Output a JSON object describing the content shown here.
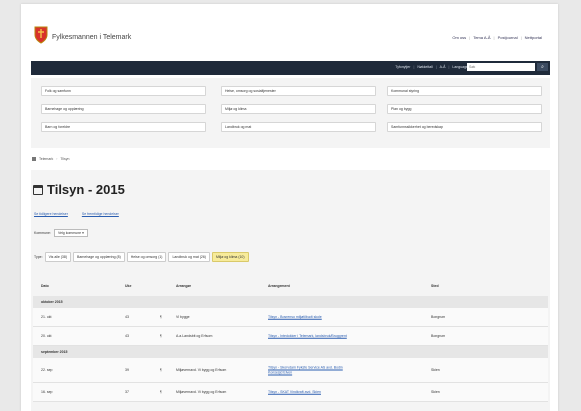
{
  "header": {
    "site_title": "Fylkesmannen i Telemark",
    "top_links": [
      "Om oss",
      "Tema A-Å",
      "Postjournal",
      "Nettportal"
    ]
  },
  "navbar": {
    "links": [
      "Tyfonytjer",
      "Nøkkeltall",
      "A-Å",
      "Language"
    ],
    "search_placeholder": "Søk",
    "search_icon_glyph": "⌕"
  },
  "menu": {
    "col1": [
      "Folk og samfunn",
      "Barnehage og opplæring",
      "Barn og foreldre"
    ],
    "col2": [
      "Helse, omsorg og sosialtjenester",
      "Miljø og klima",
      "Landbruk og mat"
    ],
    "col3": [
      "Kommunal styring",
      "Plan og bygg",
      "Samfunnssikkerhet og beredskap"
    ]
  },
  "breadcrumb": [
    "Telemark",
    "Tilsyn"
  ],
  "page": {
    "title": "Tilsyn - 2015",
    "sub_links": [
      "Se tidligere hendelser",
      "Se fremtidige hendelser"
    ],
    "kommune_label": "Kommune:",
    "kommune_value": "Velg kommune",
    "type_label": "Type:",
    "type_filters": [
      {
        "label": "Vis alle (38)",
        "active": false
      },
      {
        "label": "Barnehage og opplæring (8)",
        "active": false
      },
      {
        "label": "Helse og omsorg (1)",
        "active": false
      },
      {
        "label": "Landbruk og mat (26)",
        "active": false
      },
      {
        "label": "Miljø og klima (10)",
        "active": true
      }
    ]
  },
  "table": {
    "headers": [
      "Dato",
      "Uke",
      "Arrangør",
      "Arrangement",
      "Sted"
    ],
    "groups": [
      {
        "label": "oktober 2015",
        "rows": [
          {
            "dato": "21. okt",
            "uke": "43",
            "icon": "¶",
            "arr": "Vi bygge",
            "event": "Tilsyn - Bosrenso miljøtilbudt skole",
            "sted": "Bongrum"
          },
          {
            "dato": "20. okt",
            "uke": "43",
            "icon": "¶",
            "arr": "A.a.Landsbit og Erfsom",
            "event": "Tilsyn - Intedokker i Telemark, landsbruk/Bruggrent",
            "sted": "Bongrum"
          }
        ]
      },
      {
        "label": "september 2015",
        "rows": [
          {
            "dato": "22. sep",
            "uke": "39",
            "icon": "¶",
            "arr": "Miljøvernavd. Vi bygg og Erfsom",
            "event": "Tilsyn - Skorvdam Fyksfe Service AS avd. Bodin Konsesjd Elven",
            "sted": "Skien"
          },
          {
            "dato": "16. sep",
            "uke": "37",
            "icon": "¶",
            "arr": "Miljøvernavd. Vi bygg og Erfsom",
            "event": "Tilsyn - SKAT Vindkraft avd. Skien",
            "sted": "Skien"
          }
        ]
      }
    ]
  },
  "colors": {
    "navbar": "#1f2a3a",
    "active_filter": "#f7eb9a",
    "link": "#2a5db0"
  }
}
